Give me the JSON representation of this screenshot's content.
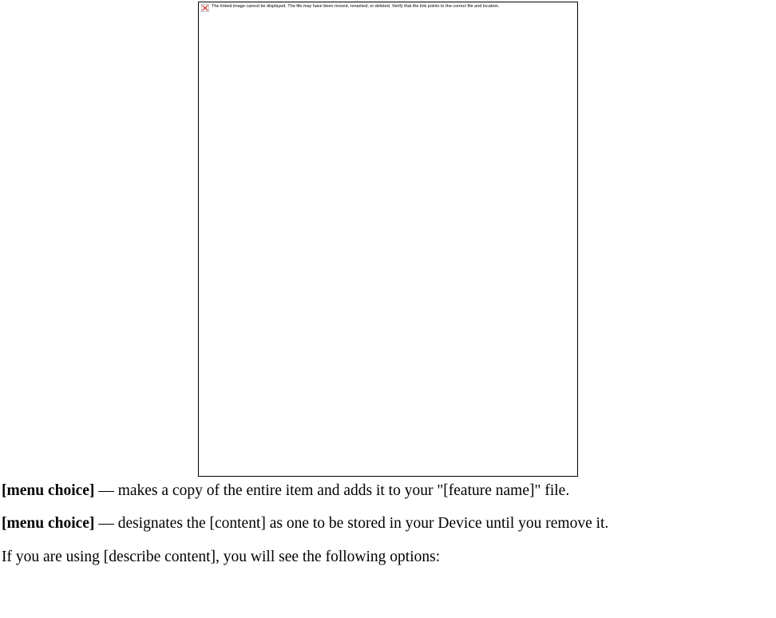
{
  "imagePlaceholder": {
    "text": "The linked image cannot be displayed.  The file may have been moved, renamed, or deleted. Verify that the link points to the correct file and location."
  },
  "entries": [
    {
      "label": "[menu choice]",
      "sep": " — ",
      "text": "makes a copy of the entire item and adds it to your \"[feature name]\" file."
    },
    {
      "label": "[menu choice]",
      "sep": " — ",
      "text": "designates the [content] as one to be stored in your Device until you remove it."
    }
  ],
  "followup": "If you are using [describe content], you will see the following options:"
}
